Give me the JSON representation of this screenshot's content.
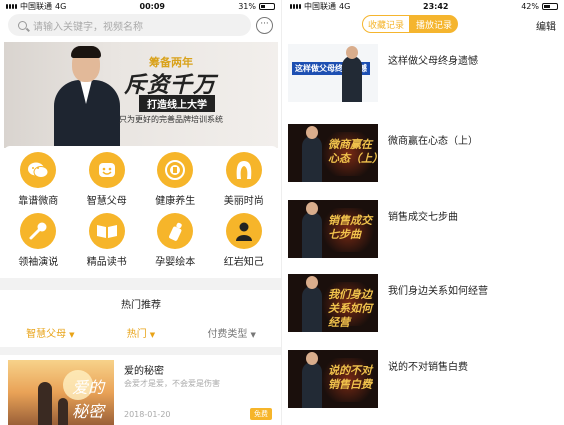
{
  "left": {
    "status": {
      "carrier": "中国联通",
      "network": "4G",
      "time": "00:09",
      "battery": "31%",
      "battery_level": 0.31
    },
    "search": {
      "placeholder": "请输入关键字，视频名称",
      "chat_icon": "chat-bubble-icon"
    },
    "banner": {
      "line1": "筹备两年",
      "line2": "斥资千万",
      "line3": "打造线上大学",
      "line4": "只为更好的完善品牌培训系统"
    },
    "categories": [
      {
        "label": "靠谱微商",
        "icon": "wechat-icon"
      },
      {
        "label": "智慧父母",
        "icon": "smile-icon"
      },
      {
        "label": "健康养生",
        "icon": "health-seal-icon"
      },
      {
        "label": "美丽时尚",
        "icon": "hair-icon"
      },
      {
        "label": "领袖演说",
        "icon": "microphone-icon"
      },
      {
        "label": "精品读书",
        "icon": "book-icon"
      },
      {
        "label": "孕婴绘本",
        "icon": "baby-bottle-icon"
      },
      {
        "label": "红岩知己",
        "icon": "person-icon"
      }
    ],
    "section_title": "热门推荐",
    "filters": [
      "智慧父母",
      "热门",
      "付费类型"
    ],
    "item": {
      "title": "爱的秘密",
      "subtitle": "会爱才是爱，不会爱是伤害",
      "date": "2018-01-20",
      "badge": "免费",
      "thumb_text": "爱的秘密"
    }
  },
  "right": {
    "status": {
      "carrier": "中国联通",
      "network": "4G",
      "time": "23:42",
      "battery": "42%",
      "battery_level": 0.42
    },
    "tabs": [
      "收藏记录",
      "播放记录"
    ],
    "edit_label": "编辑",
    "history": [
      {
        "title": "这样做父母终身遗憾",
        "thumb": "这样做父母终身遗憾"
      },
      {
        "title": "微商赢在心态（上）",
        "thumb": "微商赢在心态（上）"
      },
      {
        "title": "销售成交七步曲",
        "thumb": "销售成交七步曲"
      },
      {
        "title": "我们身边关系如何经营",
        "thumb": "我们身边关系如何经营"
      },
      {
        "title": "说的不对销售白费",
        "thumb": "说的不对销售白费"
      }
    ]
  }
}
